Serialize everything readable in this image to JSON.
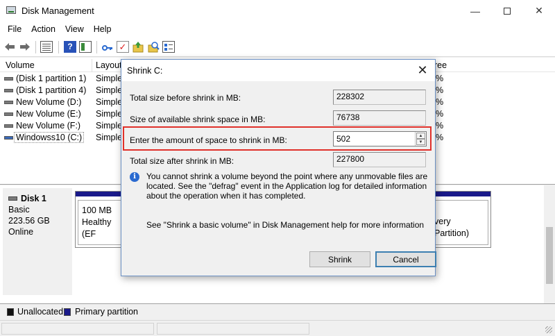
{
  "window": {
    "title": "Disk Management"
  },
  "menu": [
    "File",
    "Action",
    "View",
    "Help"
  ],
  "volume_list": {
    "columns": {
      "volume": "Volume",
      "layout": "Layout",
      "free": "ree"
    },
    "rows": [
      {
        "name": "(Disk 1 partition 1)",
        "layout": "Simple",
        "free": "%"
      },
      {
        "name": "(Disk 1 partition 4)",
        "layout": "Simple",
        "free": "%"
      },
      {
        "name": "New Volume (D:)",
        "layout": "Simple",
        "free": "%"
      },
      {
        "name": "New Volume (E:)",
        "layout": "Simple",
        "free": "%"
      },
      {
        "name": "New Volume (F:)",
        "layout": "Simple",
        "free": "%"
      },
      {
        "name": "Windowss10 (C:)",
        "layout": "Simple",
        "free": "%"
      }
    ]
  },
  "disk": {
    "name": "Disk 1",
    "type": "Basic",
    "size": "223.56 GB",
    "status": "Online",
    "partitions": [
      {
        "size": "100 MB",
        "status": "Healthy (EF"
      },
      {
        "status": "very Partition)"
      }
    ]
  },
  "legend": {
    "unallocated": "Unallocated",
    "primary": "Primary partition"
  },
  "dialog": {
    "title": "Shrink C:",
    "total_before_label": "Total size before shrink in MB:",
    "total_before_value": "228302",
    "available_label": "Size of available shrink space in MB:",
    "available_value": "76738",
    "amount_label": "Enter the amount of space to shrink in MB:",
    "amount_value": "502",
    "total_after_label": "Total size after shrink in MB:",
    "total_after_value": "227800",
    "info": "You cannot shrink a volume beyond the point where any unmovable files are located. See the \"defrag\" event in the Application log for detailed information about the operation when it has completed.",
    "help": "See \"Shrink a basic volume\" in Disk Management help for more information",
    "shrink_button": "Shrink",
    "cancel_button": "Cancel"
  }
}
